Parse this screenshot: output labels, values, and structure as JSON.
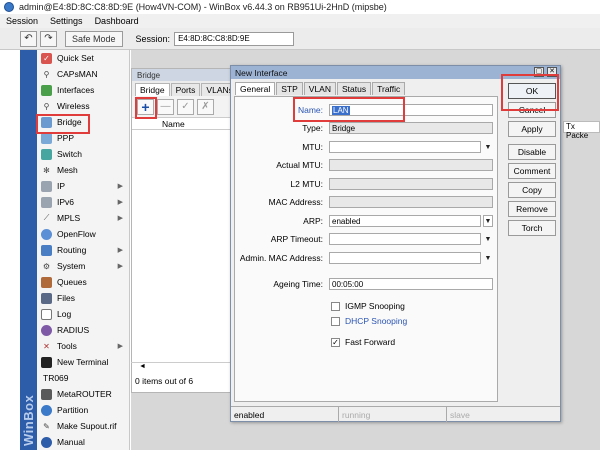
{
  "window": {
    "title": "admin@E4:8D:8C:C8:8D:9E (How4VN-COM) - WinBox v6.44.3 on RB951Ui-2HnD (mipsbe)"
  },
  "menu": [
    "Session",
    "Settings",
    "Dashboard"
  ],
  "toolbar": {
    "undo": "↶",
    "redo": "↷",
    "safe_mode": "Safe Mode",
    "session_label": "Session:",
    "session_value": "E4:8D:8C:C8:8D:9E"
  },
  "brand": "WinBox",
  "sidebar": {
    "items": [
      {
        "label": "Quick Set",
        "icon": "quick-set-icon",
        "arrow": ""
      },
      {
        "label": "CAPsMAN",
        "icon": "capsman-icon",
        "arrow": ""
      },
      {
        "label": "Interfaces",
        "icon": "interfaces-icon",
        "arrow": ""
      },
      {
        "label": "Wireless",
        "icon": "wireless-icon",
        "arrow": ""
      },
      {
        "label": "Bridge",
        "icon": "bridge-icon",
        "arrow": ""
      },
      {
        "label": "PPP",
        "icon": "ppp-icon",
        "arrow": ""
      },
      {
        "label": "Switch",
        "icon": "switch-icon",
        "arrow": ""
      },
      {
        "label": "Mesh",
        "icon": "mesh-icon",
        "arrow": ""
      },
      {
        "label": "IP",
        "icon": "ip-icon",
        "arrow": "▶"
      },
      {
        "label": "IPv6",
        "icon": "ipv6-icon",
        "arrow": "▶"
      },
      {
        "label": "MPLS",
        "icon": "mpls-icon",
        "arrow": "▶"
      },
      {
        "label": "OpenFlow",
        "icon": "openflow-icon",
        "arrow": ""
      },
      {
        "label": "Routing",
        "icon": "routing-icon",
        "arrow": "▶"
      },
      {
        "label": "System",
        "icon": "system-icon",
        "arrow": "▶"
      },
      {
        "label": "Queues",
        "icon": "queues-icon",
        "arrow": ""
      },
      {
        "label": "Files",
        "icon": "files-icon",
        "arrow": ""
      },
      {
        "label": "Log",
        "icon": "log-icon",
        "arrow": ""
      },
      {
        "label": "RADIUS",
        "icon": "radius-icon",
        "arrow": ""
      },
      {
        "label": "Tools",
        "icon": "tools-icon",
        "arrow": "▶"
      },
      {
        "label": "New Terminal",
        "icon": "terminal-icon",
        "arrow": ""
      },
      {
        "label": "TR069",
        "icon": "",
        "arrow": ""
      },
      {
        "label": "MetaROUTER",
        "icon": "metarouter-icon",
        "arrow": ""
      },
      {
        "label": "Partition",
        "icon": "partition-icon",
        "arrow": ""
      },
      {
        "label": "Make Supout.rif",
        "icon": "supout-icon",
        "arrow": ""
      },
      {
        "label": "Manual",
        "icon": "manual-icon",
        "arrow": ""
      }
    ]
  },
  "bridge_window": {
    "title": "Bridge",
    "tabs": [
      "Bridge",
      "Ports",
      "VLANs"
    ],
    "add": "+",
    "remove": "—",
    "enable": "✓",
    "disable": "✗",
    "column_name": "Name",
    "tx_column": "Tx Packe",
    "scroll_arrow": "◄",
    "status": "0 items out of 6"
  },
  "dialog": {
    "title": "New Interface",
    "minimize": "▢",
    "close": "✕",
    "tabs": [
      "General",
      "STP",
      "VLAN",
      "Status",
      "Traffic"
    ],
    "fields": {
      "name_label": "Name:",
      "name_value": "LAN",
      "type_label": "Type:",
      "type_value": "Bridge",
      "mtu_label": "MTU:",
      "mtu_value": "",
      "actual_mtu_label": "Actual MTU:",
      "actual_mtu_value": "",
      "l2_mtu_label": "L2 MTU:",
      "l2_mtu_value": "",
      "mac_label": "MAC Address:",
      "mac_value": "",
      "arp_label": "ARP:",
      "arp_value": "enabled",
      "arp_timeout_label": "ARP Timeout:",
      "arp_timeout_value": "",
      "admin_mac_label": "Admin. MAC Address:",
      "admin_mac_value": "",
      "ageing_label": "Ageing Time:",
      "ageing_value": "00:05:00"
    },
    "checkboxes": {
      "igmp_label": "IGMP Snooping",
      "igmp_mark": "",
      "dhcp_label": "DHCP Snooping",
      "dhcp_mark": "",
      "ff_label": "Fast Forward",
      "ff_mark": "✓"
    },
    "dropdown_arrow": "▼",
    "buttons": {
      "ok": "OK",
      "cancel": "Cancel",
      "apply": "Apply",
      "disable": "Disable",
      "comment": "Comment",
      "copy": "Copy",
      "remove": "Remove",
      "torch": "Torch"
    },
    "status": {
      "state": "enabled",
      "running": "running",
      "slave": "slave"
    }
  },
  "colors": {
    "highlight": "#e03c3c",
    "brand_blue": "#2d5ca8",
    "dialog_title": "#9cb3d3"
  }
}
